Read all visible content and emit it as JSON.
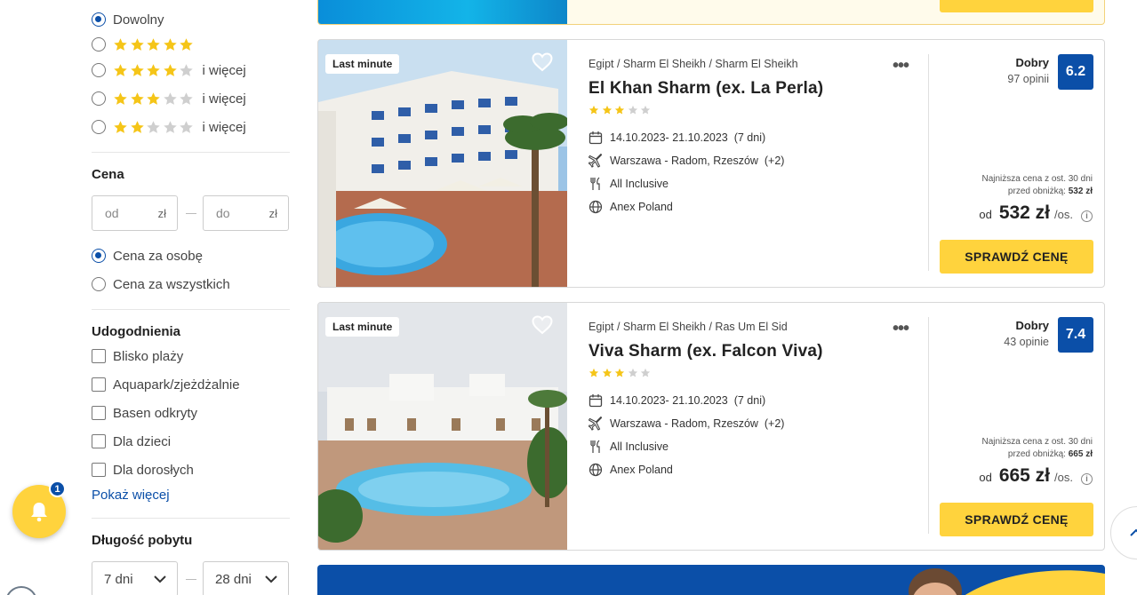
{
  "filters": {
    "stars": {
      "any_label": "Dowolny",
      "more_label": "i więcej",
      "options": [
        {
          "rating": 5,
          "show_more": false
        },
        {
          "rating": 4,
          "show_more": true
        },
        {
          "rating": 3,
          "show_more": true
        },
        {
          "rating": 2,
          "show_more": true
        }
      ]
    },
    "price": {
      "title": "Cena",
      "from_placeholder": "od",
      "to_placeholder": "do",
      "currency": "zł",
      "per_person_label": "Cena za osobę",
      "per_all_label": "Cena za wszystkich"
    },
    "amenities": {
      "title": "Udogodnienia",
      "items": [
        "Blisko plaży",
        "Aquapark/zjeżdżalnie",
        "Basen odkryty",
        "Dla dzieci",
        "Dla dorosłych"
      ],
      "show_more": "Pokaż więcej"
    },
    "duration": {
      "title": "Długość pobytu",
      "min": "7 dni",
      "max": "28 dni"
    }
  },
  "notifications": {
    "count": "1"
  },
  "offers": [
    {
      "badge": "Last minute",
      "breadcrumb": "Egipt / Sharm El Sheikh / Sharm El Sheikh",
      "name": "El Khan Sharm (ex. La Perla)",
      "stars": 3,
      "dates": "14.10.2023- 21.10.2023",
      "nights": "(7 dni)",
      "departure": "Warszawa - Radom, Rzeszów",
      "departure_extra": "(+2)",
      "board": "All Inclusive",
      "operator": "Anex Poland",
      "rating_word": "Dobry",
      "reviews": "97 opinii",
      "score": "6.2",
      "lowest_note": "Najniższa cena z ost. 30 dni",
      "before_discount_label": "przed obniżką:",
      "before_discount_value": "532 zł",
      "price_from": "od",
      "price": "532 zł",
      "per": "/os.",
      "cta": "SPRAWDŹ CENĘ"
    },
    {
      "badge": "Last minute",
      "breadcrumb": "Egipt / Sharm El Sheikh / Ras Um El Sid",
      "name": "Viva Sharm (ex. Falcon Viva)",
      "stars": 3,
      "dates": "14.10.2023- 21.10.2023",
      "nights": "(7 dni)",
      "departure": "Warszawa - Radom, Rzeszów",
      "departure_extra": "(+2)",
      "board": "All Inclusive",
      "operator": "Anex Poland",
      "rating_word": "Dobry",
      "reviews": "43 opinie",
      "score": "7.4",
      "lowest_note": "Najniższa cena z ost. 30 dni",
      "before_discount_label": "przed obniżką:",
      "before_discount_value": "665 zł",
      "price_from": "od",
      "price": "665 zł",
      "per": "/os.",
      "cta": "SPRAWDŹ CENĘ"
    }
  ],
  "colors": {
    "accent": "#0b4fa8",
    "cta": "#ffd33d",
    "star": "#f5c518",
    "star_empty": "#cfcfcf"
  }
}
